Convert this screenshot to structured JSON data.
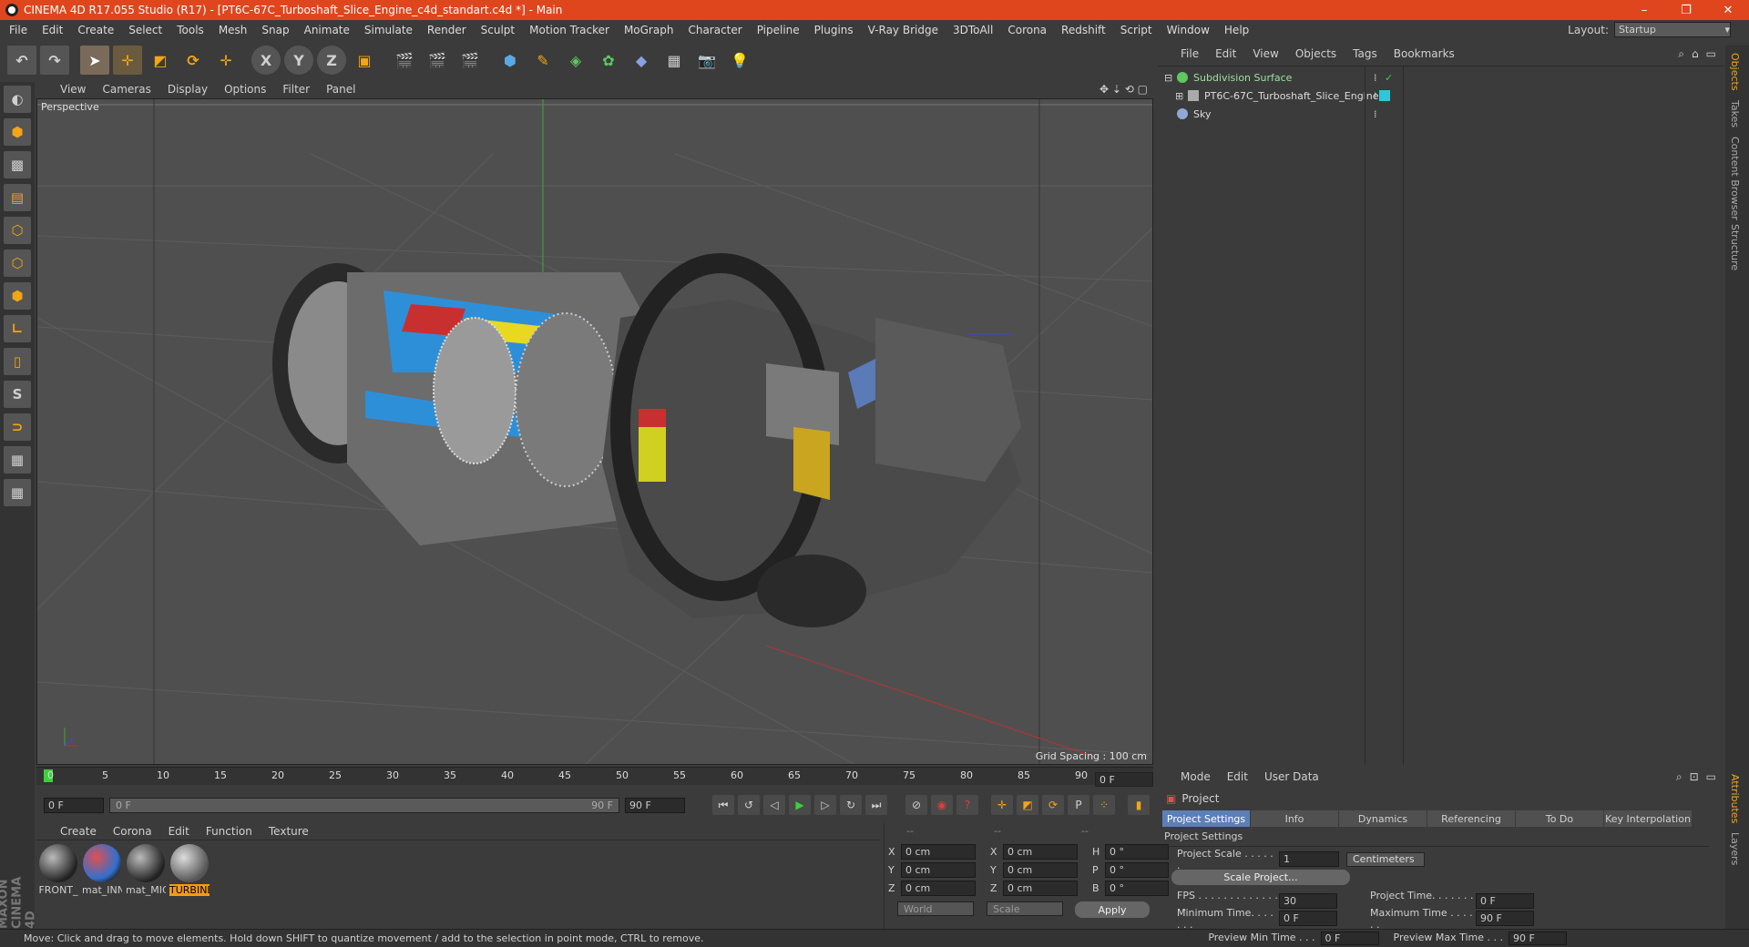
{
  "window": {
    "title": "CINEMA 4D R17.055 Studio (R17) - [PT6C-67C_Turboshaft_Slice_Engine_c4d_standart.c4d *] - Main",
    "minimize": "–",
    "restore": "❐",
    "close": "✕"
  },
  "menubar": [
    "File",
    "Edit",
    "Create",
    "Select",
    "Tools",
    "Mesh",
    "Snap",
    "Animate",
    "Simulate",
    "Render",
    "Sculpt",
    "Motion Tracker",
    "MoGraph",
    "Character",
    "Pipeline",
    "Plugins",
    "V-Ray Bridge",
    "3DToAll",
    "Corona",
    "Redshift",
    "Script",
    "Window",
    "Help"
  ],
  "layout": {
    "label": "Layout:",
    "value": "Startup"
  },
  "toolbar": {
    "x": "X",
    "y": "Y",
    "z": "Z"
  },
  "viewport": {
    "menu": [
      "View",
      "Cameras",
      "Display",
      "Options",
      "Filter",
      "Panel"
    ],
    "label": "Perspective",
    "grid": "Grid Spacing : 100 cm"
  },
  "timeline": {
    "ticks": [
      "0",
      "5",
      "10",
      "15",
      "20",
      "25",
      "30",
      "35",
      "40",
      "45",
      "50",
      "55",
      "60",
      "65",
      "70",
      "75",
      "80",
      "85",
      "90"
    ],
    "frame": "0 F",
    "start": "0 F",
    "slider_start": "0 F",
    "slider_end": "90 F",
    "end": "90 F"
  },
  "materials": {
    "menu": [
      "Create",
      "Corona",
      "Edit",
      "Function",
      "Texture"
    ],
    "items": [
      {
        "name": "FRONT_"
      },
      {
        "name": "mat_INN"
      },
      {
        "name": "mat_MIC"
      },
      {
        "name": "TURBINE"
      }
    ]
  },
  "coords": {
    "header": [
      "--",
      "--",
      "--"
    ],
    "rows": [
      {
        "a": "X",
        "av": "0 cm",
        "b": "X",
        "bv": "0 cm",
        "c": "H",
        "cv": "0 °"
      },
      {
        "a": "Y",
        "av": "0 cm",
        "b": "Y",
        "bv": "0 cm",
        "c": "P",
        "cv": "0 °"
      },
      {
        "a": "Z",
        "av": "0 cm",
        "b": "Z",
        "bv": "0 cm",
        "c": "B",
        "cv": "0 °"
      }
    ],
    "world": "World",
    "scale": "Scale",
    "apply": "Apply"
  },
  "objects": {
    "menu": [
      "File",
      "Edit",
      "View",
      "Objects",
      "Tags",
      "Bookmarks"
    ],
    "items": [
      {
        "name": "Subdivision Surface",
        "color": "#5fc85f"
      },
      {
        "name": "PT6C-67C_Turboshaft_Slice_Engine",
        "color": "#aaaaaa"
      },
      {
        "name": "Sky",
        "color": "#8fa8d8"
      }
    ]
  },
  "right_tabs": [
    "Objects",
    "Takes",
    "Content Browser",
    "Structure",
    "Attributes",
    "Layers"
  ],
  "attributes": {
    "menu": [
      "Mode",
      "Edit",
      "User Data"
    ],
    "title": "Project",
    "tabs": [
      "Project Settings",
      "Info",
      "Dynamics",
      "Referencing",
      "To Do",
      "Key Interpolation"
    ],
    "section": "Project Settings",
    "project_scale_label": "Project Scale . . . . . .",
    "project_scale_value": "1",
    "project_scale_unit": "Centimeters",
    "scale_project": "Scale Project...",
    "fps_label": "FPS . . . . . . . . . . . . . . .",
    "fps_value": "30",
    "project_time_label": "Project Time. . . . . . . .",
    "project_time_value": "0 F",
    "min_time_label": "Minimum Time. . . . . . .",
    "min_time_value": "0 F",
    "max_time_label": "Maximum Time . . . . . .",
    "max_time_value": "90 F",
    "prev_min_label": "Preview Min Time . . .",
    "prev_min_value": "0 F",
    "prev_max_label": "Preview Max Time . . .",
    "prev_max_value": "90 F"
  },
  "status": "Move: Click and drag to move elements. Hold down SHIFT to quantize movement / add to the selection in point mode, CTRL to remove.",
  "maxon": "MAXON CINEMA 4D"
}
